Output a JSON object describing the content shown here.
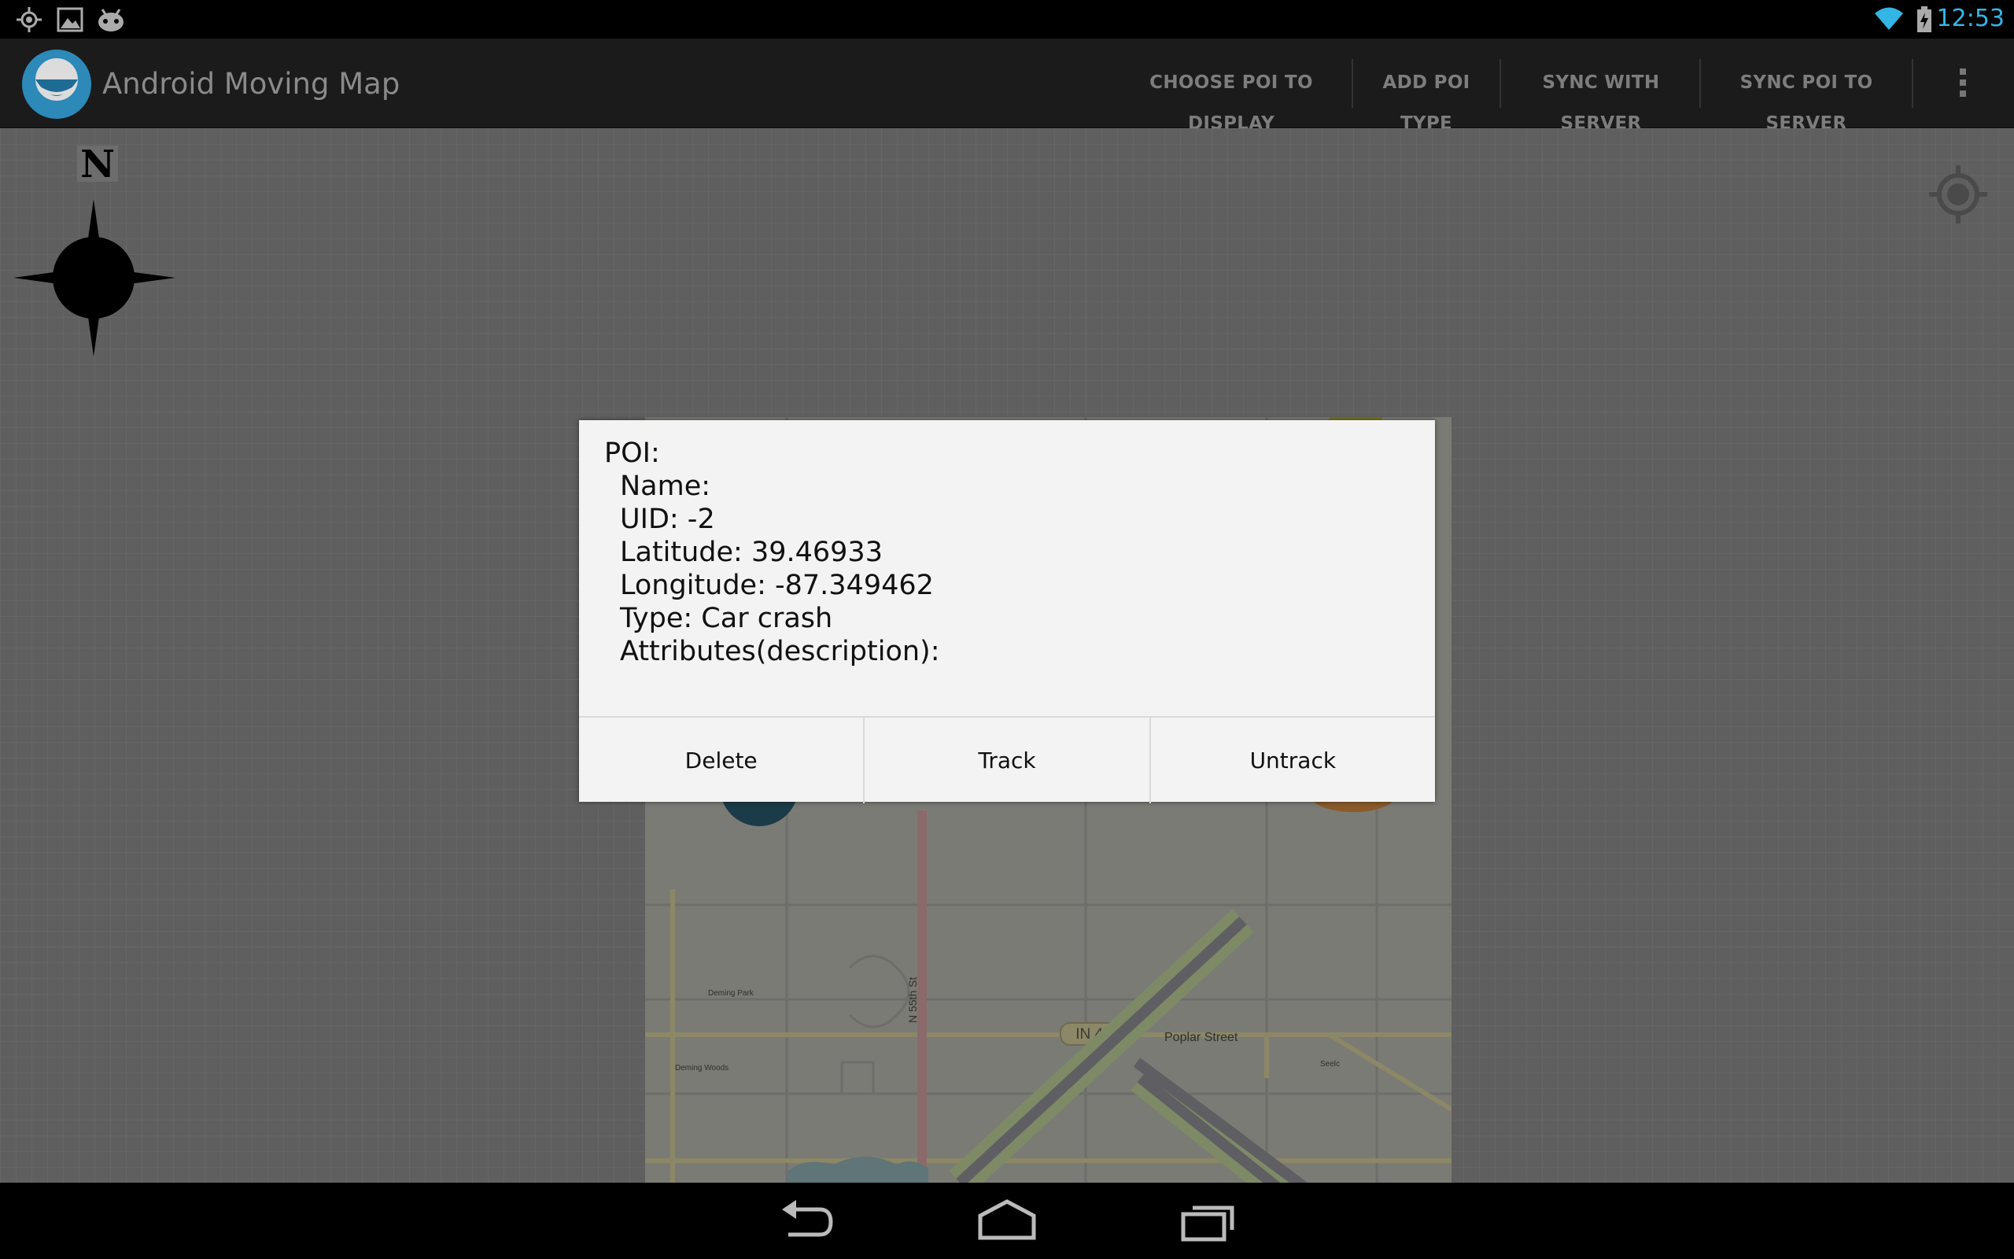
{
  "status_bar": {
    "left_icons": [
      "gps-icon",
      "image-icon",
      "android-debug-icon"
    ],
    "right_icons": [
      "wifi-icon",
      "battery-charging-icon"
    ],
    "time": "12:53",
    "accent_color": "#33b5e5"
  },
  "action_bar": {
    "title": "Android Moving Map",
    "actions": [
      {
        "label": "CHOOSE POI TO DISPLAY"
      },
      {
        "label": "ADD POI TYPE"
      },
      {
        "label": "SYNC WITH SERVER"
      },
      {
        "label": "SYNC POI TO SERVER"
      }
    ],
    "overflow_icon": "overflow-menu-icon"
  },
  "map": {
    "compass_label": "N",
    "labels": {
      "highway": "IN 42",
      "street": "Poplar Street",
      "road": "N 55th St",
      "place1": "Deming Park",
      "place2": "Deming Woods",
      "place3": "Seelc"
    },
    "locate_icon": "my-location-icon"
  },
  "dialog": {
    "lines": {
      "header": "POI:",
      "name": "Name:",
      "uid": "UID: -2",
      "latitude": "Latitude: 39.46933",
      "longitude": "Longitude: -87.349462",
      "type": "Type: Car crash",
      "attributes": "Attributes(description):"
    },
    "buttons": {
      "delete": "Delete",
      "track": "Track",
      "untrack": "Untrack"
    }
  },
  "nav_bar": {
    "buttons": [
      "back-icon",
      "home-icon",
      "recent-apps-icon"
    ]
  }
}
